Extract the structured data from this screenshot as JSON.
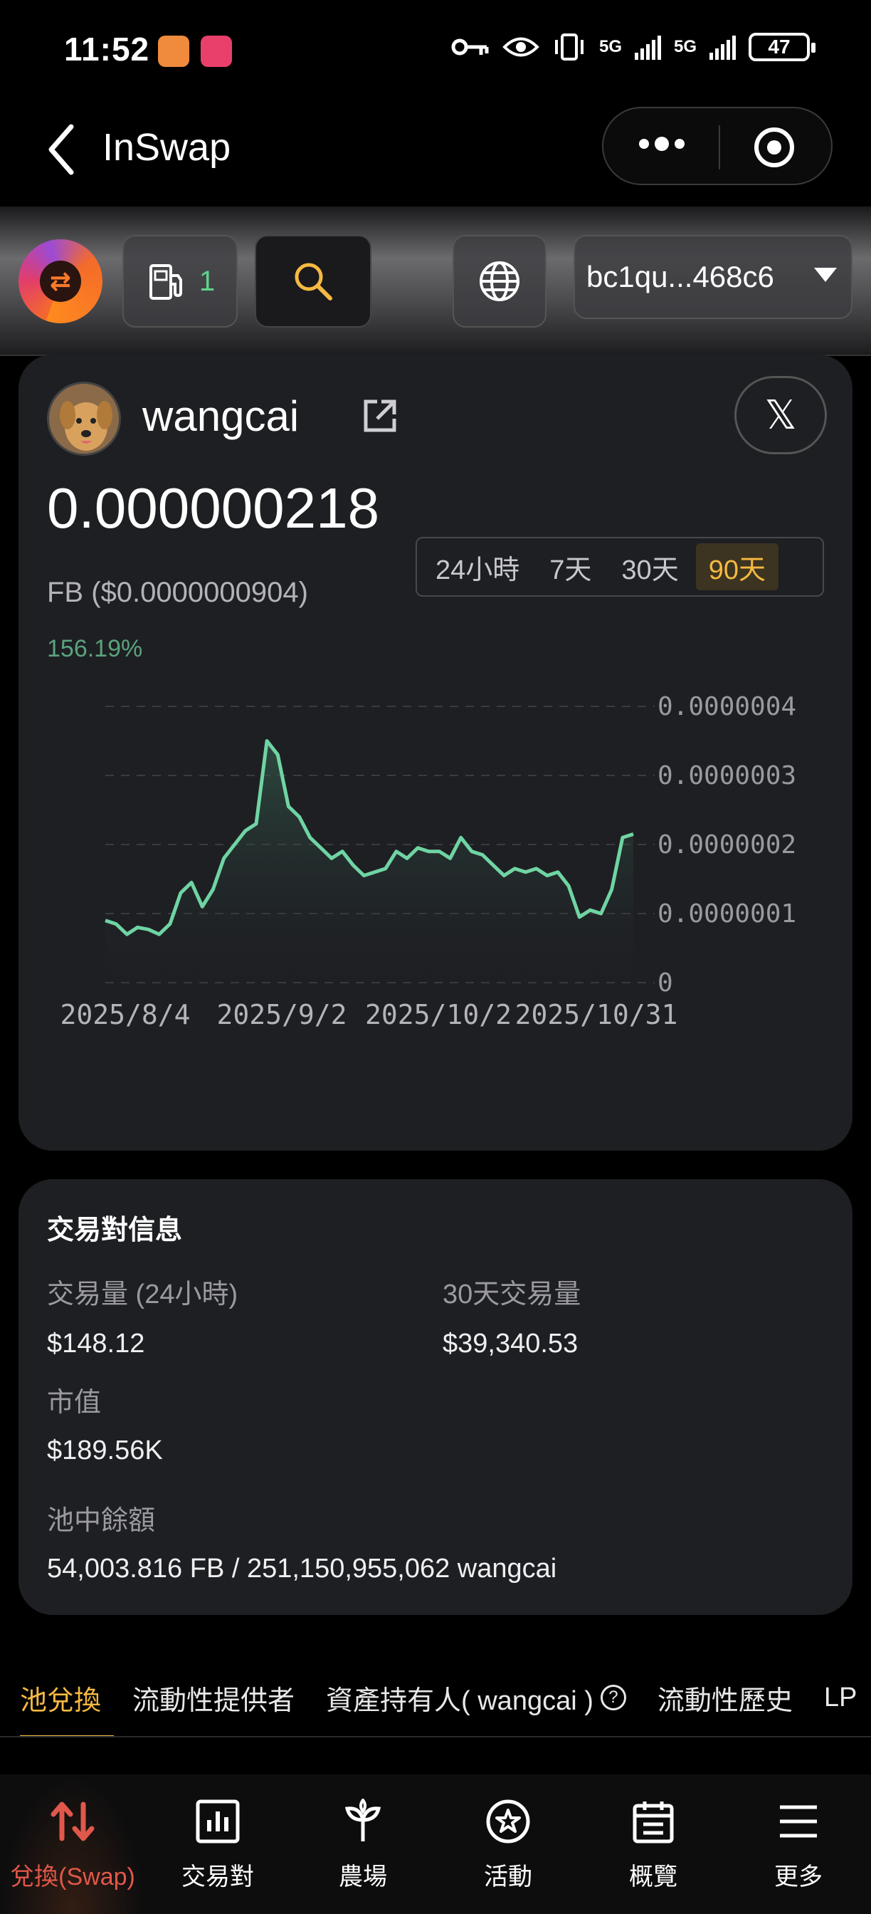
{
  "status_bar": {
    "time": "11:52",
    "network_1": "5G",
    "network_2": "5G",
    "battery": "47"
  },
  "title_bar": {
    "title": "InSwap"
  },
  "toolbar": {
    "gas_count": "1",
    "wallet_address": "bc1qu...468c6"
  },
  "token": {
    "name": "wangcai",
    "price": "0.000000218",
    "price_sub": "FB ($0.0000000904)",
    "change": "156.19%",
    "periods": [
      "24小時",
      "7天",
      "30天",
      "90天"
    ],
    "active_period": "90天"
  },
  "chart_data": {
    "type": "area",
    "color": "#6fd4a3",
    "y_ticks": [
      "0.0000004",
      "0.0000003",
      "0.0000002",
      "0.0000001",
      "0"
    ],
    "x_ticks": [
      "2025/8/4",
      "2025/9/2",
      "2025/10/2",
      "2025/10/31"
    ],
    "ylim": [
      0,
      4e-07
    ],
    "grid": true,
    "values": [
      9e-08,
      8.5e-08,
      7e-08,
      8e-08,
      7.7e-08,
      7e-08,
      8.5e-08,
      1.3e-07,
      1.45e-07,
      1.1e-07,
      1.35e-07,
      1.8e-07,
      2e-07,
      2.2e-07,
      2.3e-07,
      3.5e-07,
      3.3e-07,
      2.55e-07,
      2.4e-07,
      2.1e-07,
      1.95e-07,
      1.8e-07,
      1.9e-07,
      1.7e-07,
      1.55e-07,
      1.6e-07,
      1.65e-07,
      1.9e-07,
      1.8e-07,
      1.95e-07,
      1.9e-07,
      1.9e-07,
      1.8e-07,
      2.1e-07,
      1.9e-07,
      1.85e-07,
      1.7e-07,
      1.55e-07,
      1.65e-07,
      1.6e-07,
      1.65e-07,
      1.55e-07,
      1.6e-07,
      1.4e-07,
      9.5e-08,
      1.05e-07,
      1e-07,
      1.35e-07,
      2.1e-07,
      2.15e-07
    ]
  },
  "pair_info": {
    "title": "交易對信息",
    "volume_24h_label": "交易量 (24小時)",
    "volume_24h_value": "$148.12",
    "volume_30d_label": "30天交易量",
    "volume_30d_value": "$39,340.53",
    "market_cap_label": "市值",
    "market_cap_value": "$189.56K",
    "pool_balance_label": "池中餘額",
    "pool_balance_value": "54,003.816 FB / 251,150,955,062 wangcai"
  },
  "sub_tabs": [
    "池兌換",
    "流動性提供者",
    "資產持有人( wangcai )",
    "流動性歷史",
    "LP"
  ],
  "bottom_nav": {
    "items": [
      "兌換(Swap)",
      "交易對",
      "農場",
      "活動",
      "概覽",
      "更多"
    ]
  },
  "colors": {
    "accent": "#f5b942",
    "positive": "#5aa37d",
    "nav_active": "#e0584a"
  }
}
